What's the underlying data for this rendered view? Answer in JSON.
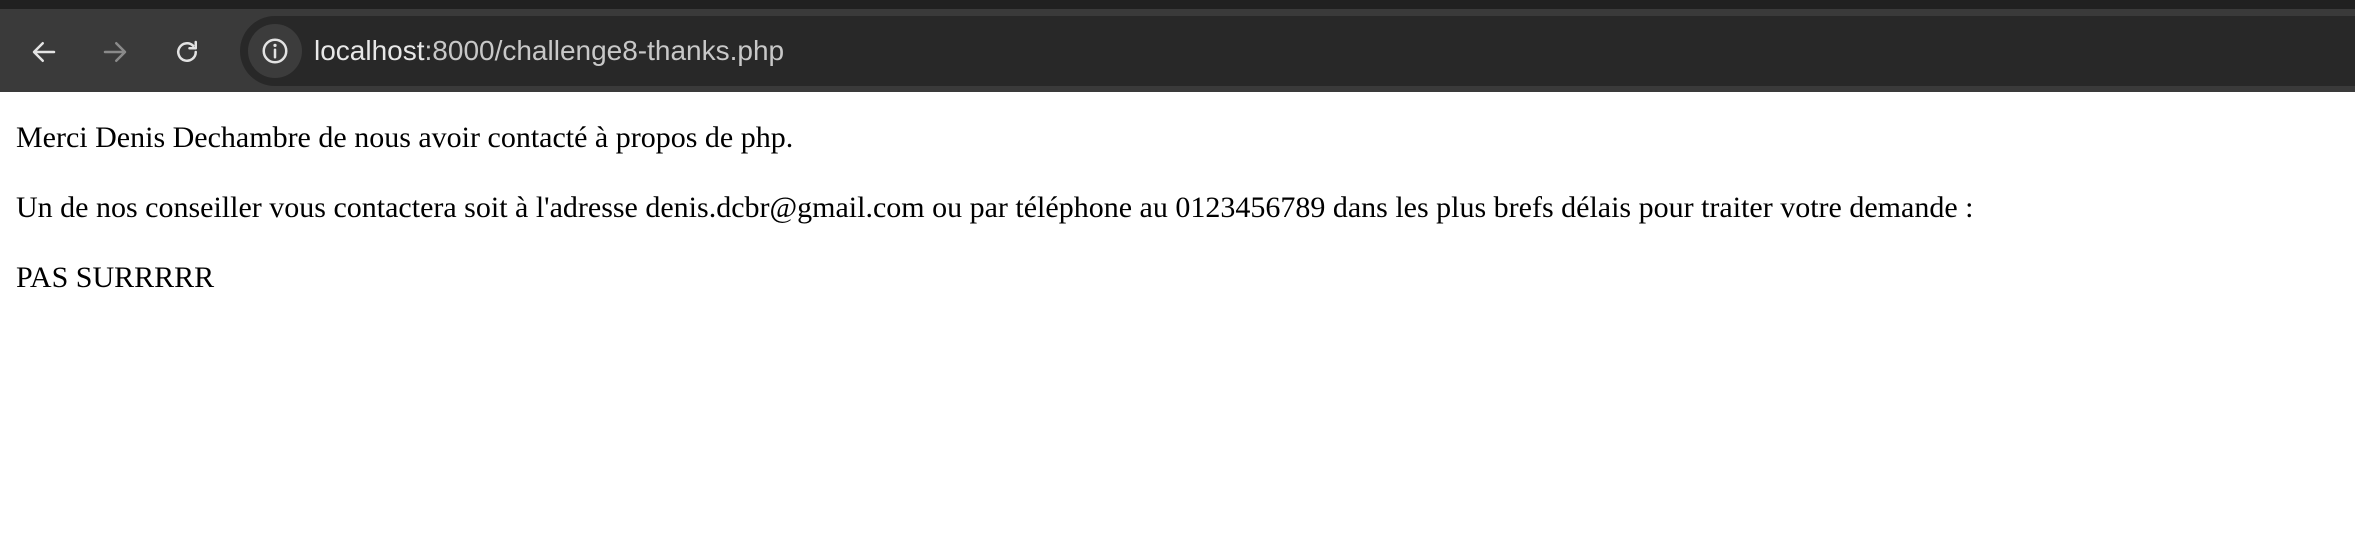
{
  "browser": {
    "url_host": "localhost",
    "url_rest": ":8000/challenge8-thanks.php"
  },
  "page": {
    "line1": "Merci Denis Dechambre de nous avoir contacté à propos de php.",
    "line2": "Un de nos conseiller vous contactera soit à l'adresse denis.dcbr@gmail.com ou par téléphone au 0123456789 dans les plus brefs délais pour traiter votre demande :",
    "line3": "PAS SURRRRR"
  },
  "colors": {
    "toolbar": "#3a3a3a",
    "omnibox": "#282828",
    "page_bg": "#ffffff"
  },
  "icons": {
    "back": "arrow-left-icon",
    "forward": "arrow-right-icon",
    "reload": "reload-icon",
    "info": "info-icon"
  }
}
